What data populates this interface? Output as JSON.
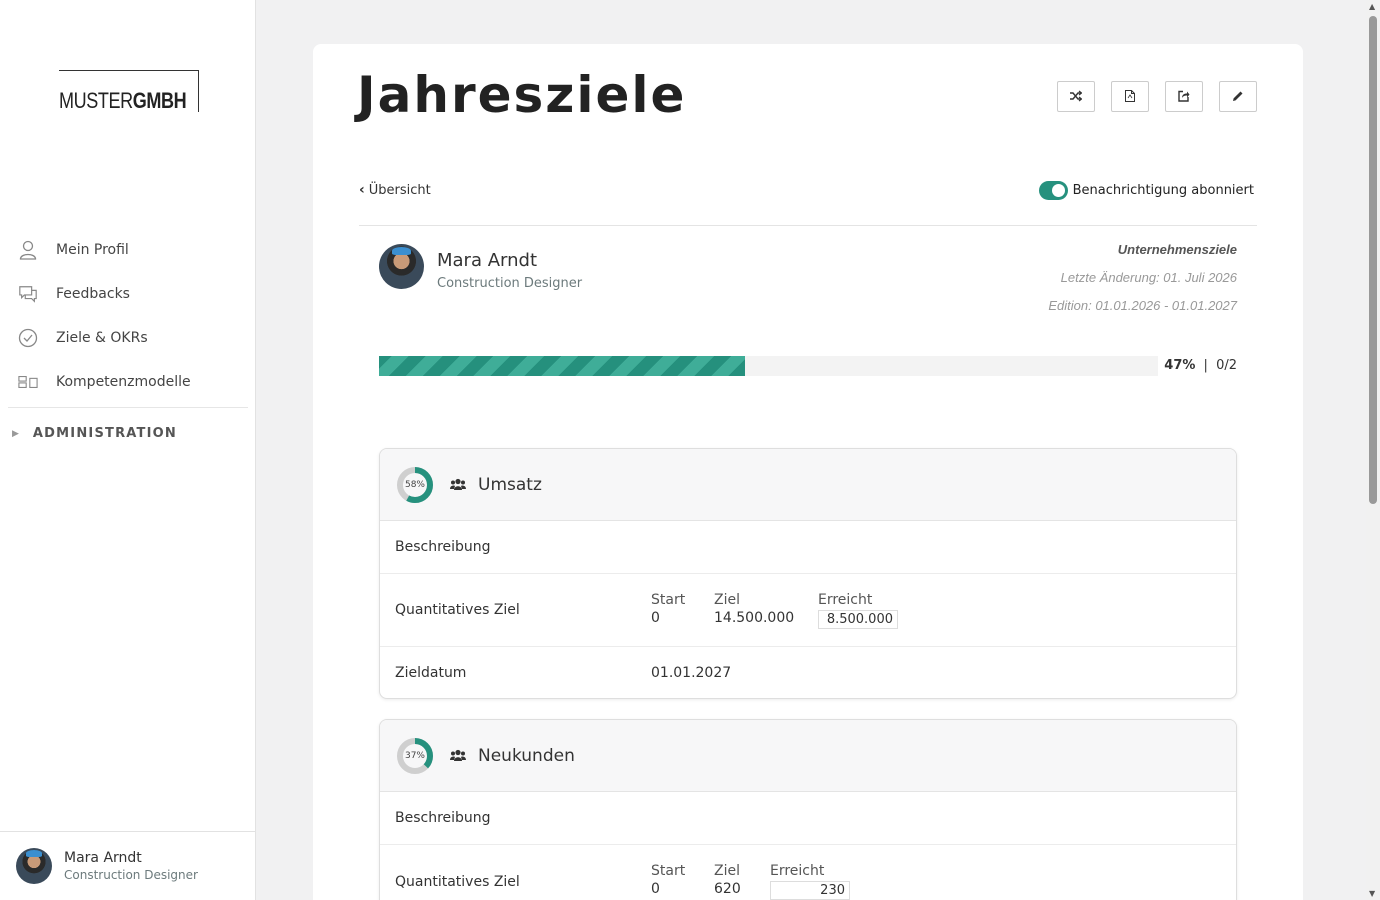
{
  "sidebar": {
    "logo": {
      "part1": "MUSTER",
      "part2": "GMBH"
    },
    "items": [
      {
        "label": "Mein Profil",
        "icon": "user-icon"
      },
      {
        "label": "Feedbacks",
        "icon": "chat-icon"
      },
      {
        "label": "Ziele & OKRs",
        "icon": "check-circle-icon"
      },
      {
        "label": "Kompetenzmodelle",
        "icon": "model-icon"
      }
    ],
    "admin_label": "ADMINISTRATION",
    "user": {
      "name": "Mara Arndt",
      "role": "Construction Designer"
    }
  },
  "page": {
    "title": "Jahresziele",
    "toolbar": [
      "shuffle-icon",
      "pdf-icon",
      "share-icon",
      "edit-icon"
    ],
    "back_label": "Übersicht",
    "subscribe_label": "Benachrichtigung abonniert",
    "subscribed": true
  },
  "owner": {
    "name": "Mara Arndt",
    "role": "Construction Designer"
  },
  "meta": {
    "kind": "Unternehmensziele",
    "last_change": "Letzte Änderung: 01. Juli 2026",
    "edition": "Edition: 01.01.2026 - 01.01.2027"
  },
  "progress": {
    "percent": 47,
    "percent_label": "47%",
    "separator": "|",
    "count": "0/2"
  },
  "goals": [
    {
      "title": "Umsatz",
      "percent": 58,
      "percent_label": "58%",
      "description_label": "Beschreibung",
      "quant_label": "Quantitatives Ziel",
      "start_label": "Start",
      "start": "0",
      "target_label": "Ziel",
      "target": "14.500.000",
      "reached_label": "Erreicht",
      "reached": "8.500.000",
      "date_label": "Zieldatum",
      "date": "01.01.2027"
    },
    {
      "title": "Neukunden",
      "percent": 37,
      "percent_label": "37%",
      "description_label": "Beschreibung",
      "quant_label": "Quantitatives Ziel",
      "start_label": "Start",
      "start": "0",
      "target_label": "Ziel",
      "target": "620",
      "reached_label": "Erreicht",
      "reached": "230"
    }
  ],
  "colors": {
    "accent": "#26917e",
    "accent_light": "#3fad98",
    "donut_track": "#cfcfcf"
  }
}
